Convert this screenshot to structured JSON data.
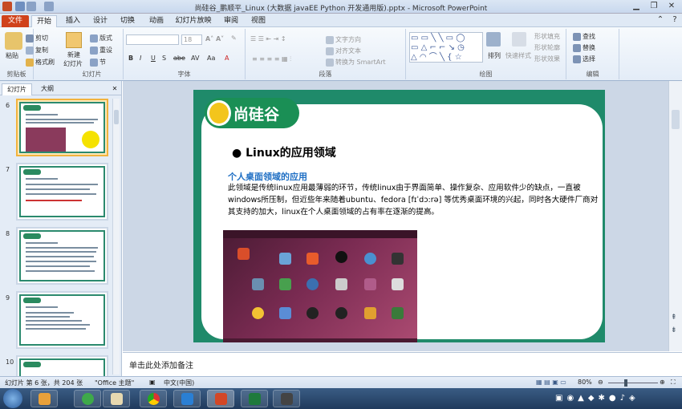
{
  "window": {
    "title": "尚硅谷_鹏顺平_Linux (大数据 javaEE Python 开发通用版).pptx - Microsoft PowerPoint"
  },
  "ribbon_tabs": [
    "文件",
    "开始",
    "插入",
    "设计",
    "切换",
    "动画",
    "幻灯片放映",
    "审阅",
    "视图"
  ],
  "clipboard": {
    "paste": "粘贴",
    "cut": "剪切",
    "copy": "复制",
    "format_painter": "格式刷",
    "group": "剪贴板"
  },
  "slides_group": {
    "new_slide": "新建",
    "new_slide2": "幻灯片",
    "layout": "版式",
    "reset": "重设",
    "section": "节",
    "group": "幻灯片"
  },
  "font_group": {
    "font_size": "18",
    "group": "字体",
    "bold": "B",
    "italic": "I",
    "underline": "U",
    "shadow": "S",
    "strike": "abe",
    "spacing": "AV",
    "case": "Aa",
    "color": "A"
  },
  "paragraph_group": {
    "text_direction": "文字方向",
    "align_text": "对齐文本",
    "smartart": "转换为 SmartArt",
    "group": "段落"
  },
  "drawing_group": {
    "arrange": "排列",
    "quick_styles": "快速样式",
    "shape_fill": "形状填充",
    "shape_outline": "形状轮廓",
    "shape_effects": "形状效果",
    "group": "绘图"
  },
  "editing_group": {
    "find": "查找",
    "replace": "替换",
    "select": "选择",
    "group": "编辑"
  },
  "left_panel": {
    "tabs": [
      "幻灯片",
      "大纲"
    ],
    "slide_numbers": [
      "6",
      "7",
      "8",
      "9",
      "10"
    ]
  },
  "slide": {
    "logo_text": "尚硅谷",
    "bullet_title": "Linux的应用领域",
    "subtitle": "个人桌面领域的应用",
    "body": "此领域是传统linux应用最薄弱的环节，传统linux由于界面简单、操作复杂、应用软件少的缺点，一直被windows所压制，但近些年来随着ubuntu、fedora [fɪˈdɔ:rə] 等优秀桌面环境的兴起，同时各大硬件厂商对其支持的加大，linux在个人桌面领域的占有率在逐渐的提高。"
  },
  "notes": {
    "placeholder": "单击此处添加备注"
  },
  "statusbar": {
    "slide_info": "幻灯片 第 6 张，共 204 张",
    "theme": "\"Office 主题\"",
    "language": "中文(中国)",
    "zoom": "80%"
  },
  "colors": {
    "accent": "#1f8a6a",
    "file_tab": "#d0421b",
    "subtitle": "#1f6fc4"
  }
}
